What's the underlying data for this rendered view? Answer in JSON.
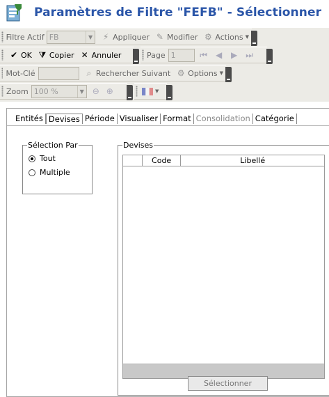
{
  "title": "Paramètres de Filtre \"FEFB\" - Sélectionner",
  "toolbar1": {
    "filter_label": "Filtre Actif",
    "filter_value": "FB",
    "apply_label": "Appliquer",
    "modify_label": "Modifier",
    "actions_label": "Actions"
  },
  "toolbar2": {
    "ok_label": "OK",
    "copy_label": "Copier",
    "cancel_label": "Annuler",
    "page_label": "Page",
    "page_value": "1"
  },
  "toolbar3": {
    "keyword_label": "Mot-Clé",
    "keyword_value": "",
    "search_next_label": "Rechercher Suivant",
    "options_label": "Options"
  },
  "toolbar4": {
    "zoom_label": "Zoom",
    "zoom_value": "100 %"
  },
  "tabs": [
    {
      "label": "Entités",
      "state": "normal"
    },
    {
      "label": "Devises",
      "state": "selected"
    },
    {
      "label": "Période",
      "state": "normal"
    },
    {
      "label": "Visualiser",
      "state": "normal"
    },
    {
      "label": "Format",
      "state": "normal"
    },
    {
      "label": "Consolidation",
      "state": "disabled"
    },
    {
      "label": "Catégorie",
      "state": "normal"
    }
  ],
  "selection": {
    "legend": "Sélection Par",
    "options": [
      {
        "label": "Tout",
        "checked": true
      },
      {
        "label": "Multiple",
        "checked": false
      }
    ]
  },
  "devises": {
    "legend": "Devises",
    "columns": [
      "Code",
      "Libellé"
    ],
    "rows": [],
    "select_button": "Sélectionner"
  },
  "colors": {
    "title": "#2a55a8",
    "toolbar_bg": "#ecebe6",
    "grid_footer": "#c8c8c8"
  }
}
